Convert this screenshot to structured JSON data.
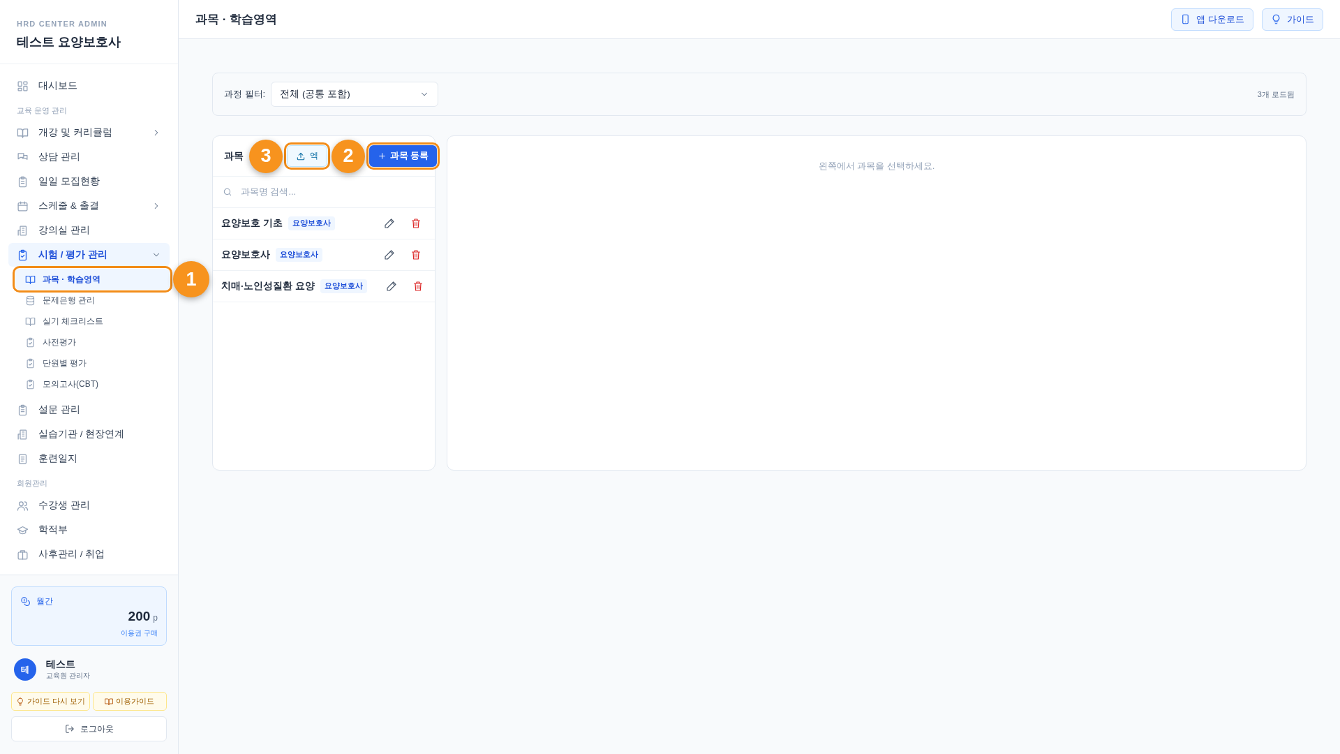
{
  "sidebar": {
    "brand_sub": "HRD CENTER ADMIN",
    "brand_title": "테스트 요양보호사",
    "nav": [
      {
        "kind": "item",
        "label": "대시보드",
        "selected": false
      },
      {
        "kind": "section",
        "label": "교육 운영 관리"
      },
      {
        "kind": "item",
        "label": "개강 및 커리큘럼",
        "selected": false,
        "expanded": false
      },
      {
        "kind": "item",
        "label": "상담 관리",
        "selected": false
      },
      {
        "kind": "item",
        "label": "일일 모집현황",
        "selected": false
      },
      {
        "kind": "item",
        "label": "스케줄 & 출결",
        "selected": false,
        "expanded": false
      },
      {
        "kind": "item",
        "label": "강의실 관리",
        "selected": false
      },
      {
        "kind": "item",
        "label": "시험 / 평가 관리",
        "selected": true,
        "expanded": true,
        "children": [
          {
            "label": "과목 · 학습영역",
            "selected": true,
            "callout": "1"
          },
          {
            "label": "문제은행 관리",
            "selected": false
          },
          {
            "label": "실기 체크리스트",
            "selected": false
          },
          {
            "label": "사전평가",
            "selected": false
          },
          {
            "label": "단원별 평가",
            "selected": false
          },
          {
            "label": "모의고사(CBT)",
            "selected": false
          }
        ]
      },
      {
        "kind": "item",
        "label": "설문 관리",
        "selected": false
      },
      {
        "kind": "item",
        "label": "실습기관 / 현장연계",
        "selected": false
      },
      {
        "kind": "item",
        "label": "훈련일지",
        "selected": false
      },
      {
        "kind": "section",
        "label": "회원관리"
      },
      {
        "kind": "item",
        "label": "수강생 관리",
        "selected": false
      },
      {
        "kind": "item",
        "label": "학적부",
        "selected": false
      },
      {
        "kind": "item",
        "label": "사후관리 / 취업",
        "selected": false
      }
    ],
    "points": {
      "title": "월간",
      "amount": "200",
      "unit": "p",
      "link": "이용권 구매"
    },
    "user": {
      "avatar": "테",
      "name": "테스트",
      "role": "교육원 관리자"
    },
    "guide_buttons": [
      "가이드 다시 보기",
      "이용가이드"
    ],
    "logout": "로그아웃"
  },
  "header": {
    "title": "과목 · 학습영역",
    "buttons": [
      "앱 다운로드",
      "가이드"
    ]
  },
  "filter": {
    "label": "과정 필터:",
    "value": "전체 (공통 포함)",
    "count": "3개 로드됨"
  },
  "subject_panel": {
    "title": "과목",
    "excel_callout": "3",
    "excel_button": "엑",
    "add_callout": "2",
    "add_button": "과목 등록",
    "search": {
      "placeholder": "과목명 검색..."
    },
    "rows": [
      {
        "name": "요양보호 기초",
        "tag": "요양보호사",
        "selected": false
      },
      {
        "name": "요양보호사",
        "tag": "요양보호사",
        "selected": false
      },
      {
        "name": "치매·노인성질환 요양",
        "tag": "요양보호사",
        "selected": false
      }
    ]
  },
  "detail_panel": {
    "empty_text": "왼쪽에서 과목을 선택하세요."
  }
}
